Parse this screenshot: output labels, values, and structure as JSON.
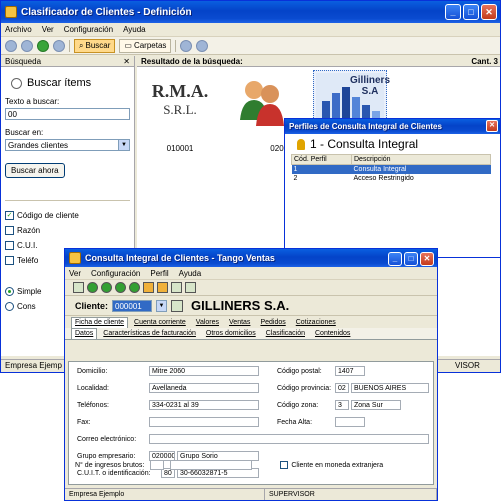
{
  "back_window": {
    "title": "Clasificador de Clientes - Definición",
    "menu": [
      "Archivo",
      "Ver",
      "Configuración",
      "Ayuda"
    ],
    "toolbar": {
      "buscar": "Buscar",
      "carpetas": "Carpetas"
    },
    "search_panel": {
      "header": "Búsqueda",
      "close": "✕",
      "title": "Buscar ítems",
      "text_label": "Texto a buscar:",
      "text_value": "00",
      "in_label": "Buscar en:",
      "in_value": "Grandes clientes",
      "button": "Buscar ahora",
      "checks": [
        {
          "label": "Código de cliente",
          "checked": true
        },
        {
          "label": "Razón",
          "checked": false
        },
        {
          "label": "C.U.I.",
          "checked": false
        },
        {
          "label": "Teléfo",
          "checked": false
        }
      ],
      "radios": [
        {
          "label": "Simple",
          "on": true
        },
        {
          "label": "Cons",
          "on": false
        }
      ]
    },
    "results": {
      "header": "Resultado de la búsqueda:",
      "count_label": "Cant. 3",
      "items": [
        {
          "code": "010001",
          "logo_line1": "R.M.A.",
          "logo_line2": "S.R.L."
        },
        {
          "code": "020025"
        },
        {
          "logo_text": "Gilliners S.A"
        }
      ]
    },
    "status": "Empresa Ejemp",
    "status_right": "VISOR"
  },
  "perfiles": {
    "title": "Perfiles de Consulta Integral de Clientes",
    "header": "1 - Consulta Integral",
    "columns": [
      "Cód. Perfil",
      "Descripción"
    ],
    "rows": [
      {
        "code": "1",
        "desc": "Consulta Integral",
        "selected": true
      },
      {
        "code": "2",
        "desc": "Acceso Restringido",
        "selected": false
      }
    ]
  },
  "front_window": {
    "title": "Consulta Integral de Clientes - Tango Ventas",
    "menu": [
      "Ver",
      "Configuración",
      "Perfil",
      "Ayuda"
    ],
    "cliente_label": "Cliente:",
    "cliente_code": "000001",
    "cliente_name": "GILLINERS S.A.",
    "tabs1": [
      "Ficha de cliente",
      "Cuenta corriente",
      "Valores",
      "Ventas",
      "Pedidos",
      "Cotizaciones"
    ],
    "tabs2": [
      "Datos",
      "Características de facturación",
      "Otros domicilios",
      "Clasificación",
      "Contenidos"
    ],
    "form": {
      "domicilio_label": "Domicilio:",
      "domicilio": "Mitre 2060",
      "localidad_label": "Localidad:",
      "localidad": "Avellaneda",
      "telefonos_label": "Teléfonos:",
      "telefonos": "334-0231 al 39",
      "fax_label": "Fax:",
      "correo_label": "Correo electrónico:",
      "grupo_label": "Grupo empresario:",
      "grupo_code": "020000",
      "grupo_name": "Grupo Sorio",
      "cuit_label": "C.U.I.T. o identificación:",
      "cuit_type": "80",
      "cuit": "30-66032871-5",
      "ingresos_label": "N° de ingresos brutos:",
      "postal_label": "Código postal:",
      "postal": "1407",
      "provincia_label": "Código provincia:",
      "provincia_code": "02",
      "provincia_name": "BUENOS AIRES",
      "zona_label": "Código zona:",
      "zona_code": "3",
      "zona_name": "Zona Sur",
      "fecha_label": "Fecha Alta:",
      "moneda_label": "Cliente en moneda extranjera"
    },
    "status_left": "Empresa Ejemplo",
    "status_right": "SUPERVISOR"
  }
}
